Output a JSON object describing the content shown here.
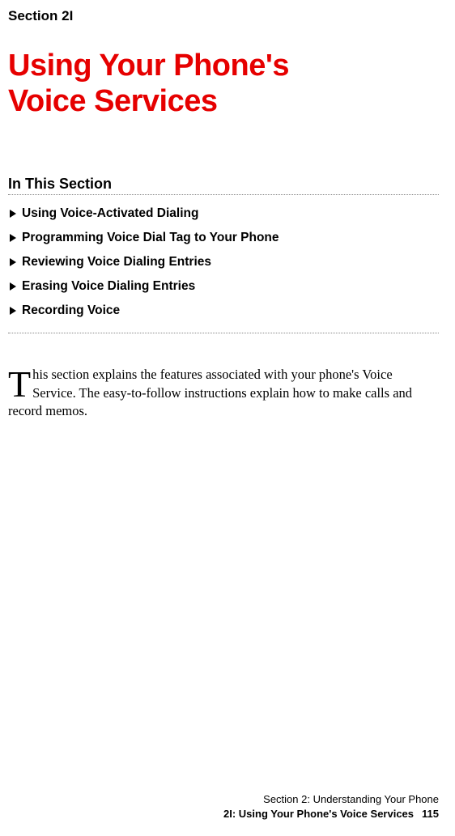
{
  "section_label": "Section 2I",
  "title_line1": "Using Your Phone's",
  "title_line2": "Voice Services",
  "subheading": "In This Section",
  "toc": {
    "items": [
      {
        "label": "Using Voice-Activated Dialing"
      },
      {
        "label": "Programming Voice Dial Tag to Your Phone"
      },
      {
        "label": "Reviewing Voice Dialing Entries"
      },
      {
        "label": "Erasing Voice Dialing Entries"
      },
      {
        "label": "Recording Voice"
      }
    ]
  },
  "body": {
    "drop_cap": "T",
    "text": "his section explains the features associated with your phone's Voice Service. The easy-to-follow instructions explain how to make calls and record memos."
  },
  "footer": {
    "line1": "Section 2: Understanding Your Phone",
    "line2_label": "2I: Using Your Phone's Voice Services",
    "page_number": "115"
  }
}
